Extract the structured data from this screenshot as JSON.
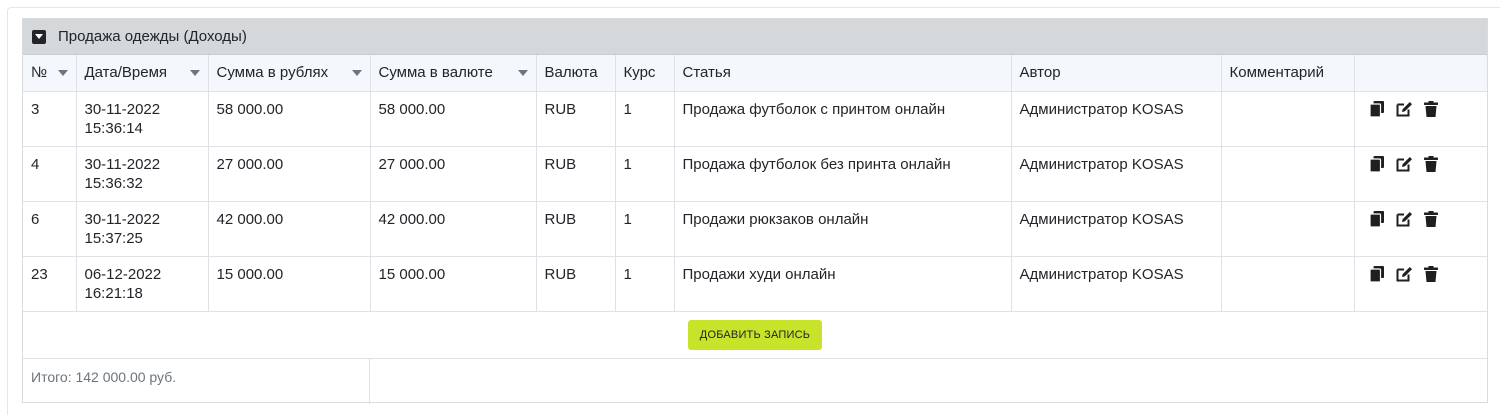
{
  "panel": {
    "title": "Продажа одежды (Доходы)"
  },
  "columns": [
    {
      "label": "№",
      "sortable": true
    },
    {
      "label": "Дата/Время",
      "sortable": true
    },
    {
      "label": "Сумма в рублях",
      "sortable": true
    },
    {
      "label": "Сумма в валюте",
      "sortable": true
    },
    {
      "label": "Валюта",
      "sortable": false
    },
    {
      "label": "Курс",
      "sortable": false
    },
    {
      "label": "Статья",
      "sortable": false
    },
    {
      "label": "Автор",
      "sortable": false
    },
    {
      "label": "Комментарий",
      "sortable": false
    },
    {
      "label": "",
      "sortable": false
    }
  ],
  "rows": [
    {
      "num": "3",
      "datetime": "30-11-2022\n15:36:14",
      "sum_rub": "58 000.00",
      "sum_cur": "58 000.00",
      "currency": "RUB",
      "rate": "1",
      "item": "Продажа футболок с принтом онлайн",
      "author": "Администратор KOSAS",
      "comment": ""
    },
    {
      "num": "4",
      "datetime": "30-11-2022\n15:36:32",
      "sum_rub": "27 000.00",
      "sum_cur": "27 000.00",
      "currency": "RUB",
      "rate": "1",
      "item": "Продажа футболок без принта онлайн",
      "author": "Администратор KOSAS",
      "comment": ""
    },
    {
      "num": "6",
      "datetime": "30-11-2022\n15:37:25",
      "sum_rub": "42 000.00",
      "sum_cur": "42 000.00",
      "currency": "RUB",
      "rate": "1",
      "item": "Продажи рюкзаков онлайн",
      "author": "Администратор KOSAS",
      "comment": ""
    },
    {
      "num": "23",
      "datetime": "06-12-2022\n16:21:18",
      "sum_rub": "15 000.00",
      "sum_cur": "15 000.00",
      "currency": "RUB",
      "rate": "1",
      "item": "Продажи худи онлайн",
      "author": "Администратор KOSAS",
      "comment": ""
    }
  ],
  "add_button_label": "ДОБАВИТЬ ЗАПИСЬ",
  "total_text": "Итого: 142 000.00 руб.",
  "icons": {
    "copy": "copy-icon",
    "edit": "edit-icon",
    "delete": "trash-icon",
    "toggle": "caret-down-square-icon"
  },
  "colors": {
    "header_bg": "#d5d8db",
    "thead_bg": "#f4f8fd",
    "add_button": "#c8e32a"
  }
}
